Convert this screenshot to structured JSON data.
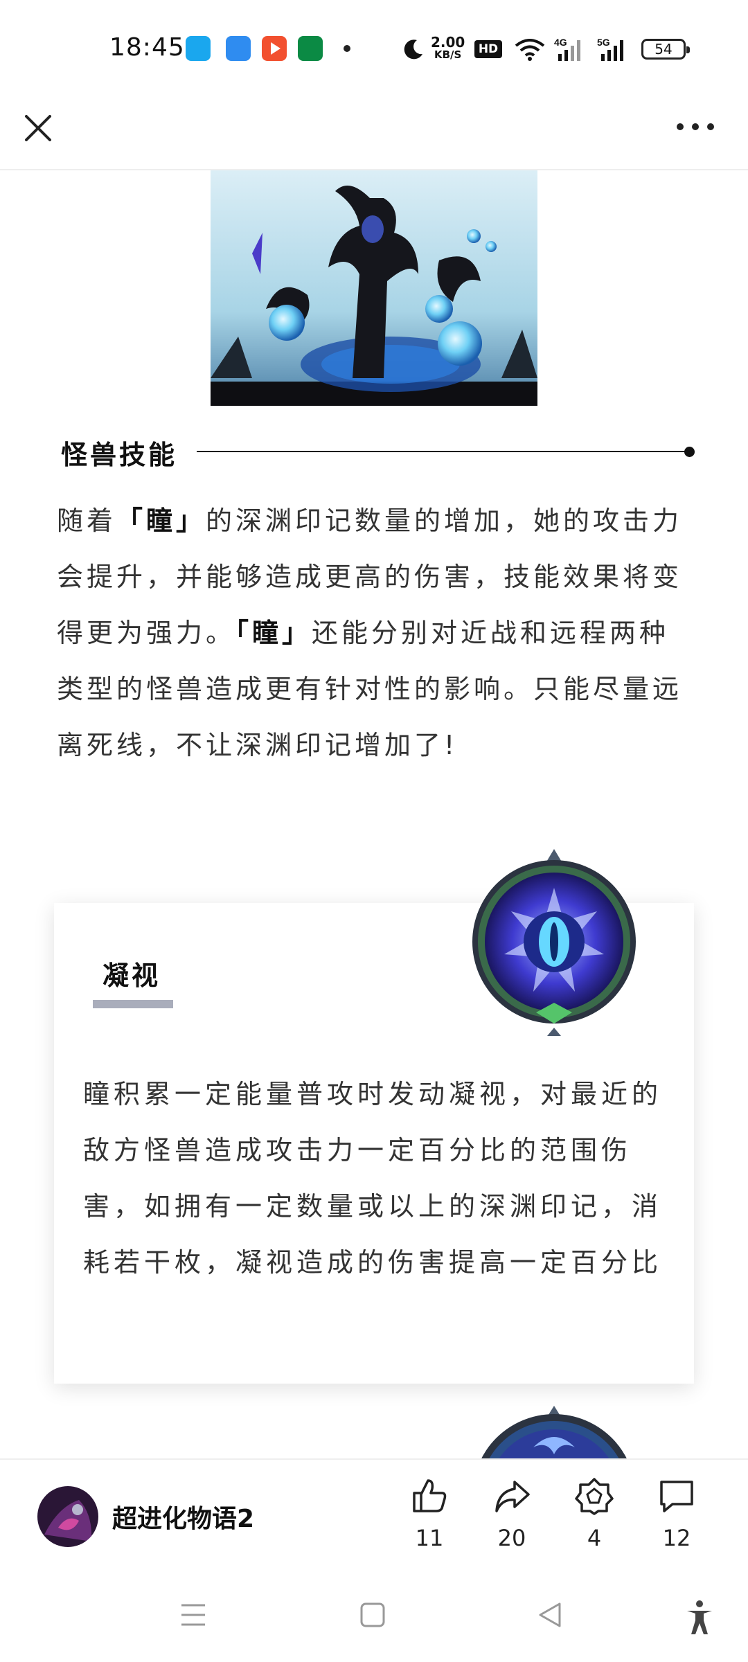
{
  "status_bar": {
    "time": "18:45",
    "network_speed_value": "2.00",
    "network_speed_unit": "KB/S",
    "hd_badge": "HD",
    "battery": "54",
    "app_icons": [
      "qq-icon",
      "blue-app-icon",
      "video-app-icon",
      "oppo-app-icon"
    ],
    "colors": {
      "qq": "#1aa7ee",
      "blue_app": "#2f8cf0",
      "video_app": "#f2502f",
      "oppo": "#0b8a44"
    }
  },
  "top_bar": {
    "close_icon": "close-icon",
    "more_icon": "more-dots-icon"
  },
  "article": {
    "section_title": "怪兽技能",
    "paragraph": [
      {
        "text": "随着",
        "bold": false
      },
      {
        "text": "「瞳」",
        "bold": true
      },
      {
        "text": "的深渊印记数量的增加，她的攻击力会提升，并能够造成更高的伤害，技能效果将变得更为强力。",
        "bold": false
      },
      {
        "text": "「瞳」",
        "bold": true
      },
      {
        "text": "还能分别对近战和远程两种类型的怪兽造成更有针对性的影响。只能尽量远离死线，不让深渊印记增加了!",
        "bold": false
      }
    ],
    "skill_card": {
      "title": "凝视",
      "description": "瞳积累一定能量普攻时发动凝视，对最近的敌方怪兽造成攻击力一定百分比的范围伤害，如拥有一定数量或以上的深渊印记，消耗若干枚，凝视造成的伤害提高一定百分比"
    }
  },
  "bottom_bar": {
    "author_name": "超进化物语2",
    "actions": [
      {
        "icon": "thumbs-up-icon",
        "count": "11"
      },
      {
        "icon": "share-icon",
        "count": "20"
      },
      {
        "icon": "badge-icon",
        "count": "4"
      },
      {
        "icon": "comment-icon",
        "count": "12"
      }
    ]
  },
  "nav_bar": {
    "icons": [
      "menu-icon",
      "home-square-icon",
      "back-triangle-icon",
      "accessibility-icon"
    ]
  }
}
